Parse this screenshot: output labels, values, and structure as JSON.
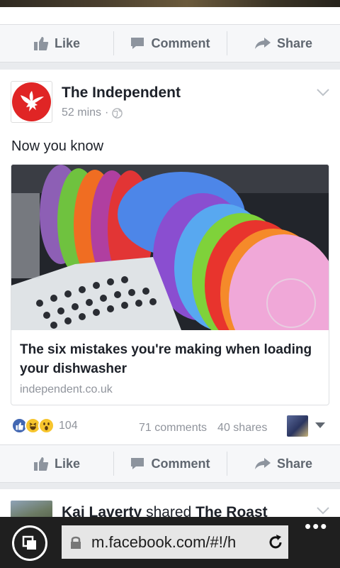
{
  "action_bar": {
    "like": "Like",
    "comment": "Comment",
    "share": "Share"
  },
  "post": {
    "page_name": "The Independent",
    "time": "52 mins",
    "separator": "·",
    "privacy_icon": "globe-icon",
    "text": "Now you know",
    "link": {
      "title": "The six mistakes you're making when loading your dishwasher",
      "domain": "independent.co.uk"
    },
    "reactions": {
      "count": "104",
      "types": [
        "like",
        "haha",
        "wow"
      ]
    },
    "comments": "71 comments",
    "shares": "40 shares"
  },
  "next_post": {
    "author": "Kai Laverty",
    "action": "shared",
    "target": "The Roast"
  },
  "browser": {
    "url": "m.facebook.com/#!/h",
    "more": "•••"
  },
  "colors": {
    "background": "#e9ebee",
    "brand_red": "#e02525",
    "like_blue": "#4267b2",
    "text_gray": "#90949c"
  }
}
